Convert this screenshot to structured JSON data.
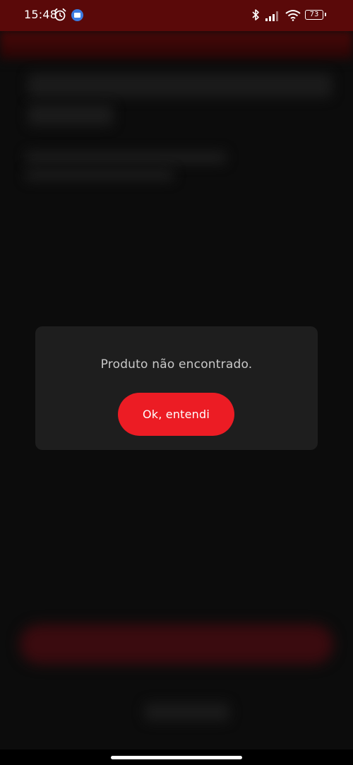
{
  "status_bar": {
    "time": "15:48",
    "battery": "73",
    "icons": [
      "alarm-icon",
      "app-notification-icon",
      "bluetooth-icon",
      "signal-icon",
      "wifi-icon",
      "battery-icon"
    ]
  },
  "dialog": {
    "message": "Produto não encontrado.",
    "button_label": "Ok, entendi"
  },
  "colors": {
    "status_bar": "#5a0909",
    "background": "#0c0c0c",
    "dialog": "#1e1e1e",
    "accent": "#ec1c24",
    "message_text": "#c9c9c9"
  }
}
